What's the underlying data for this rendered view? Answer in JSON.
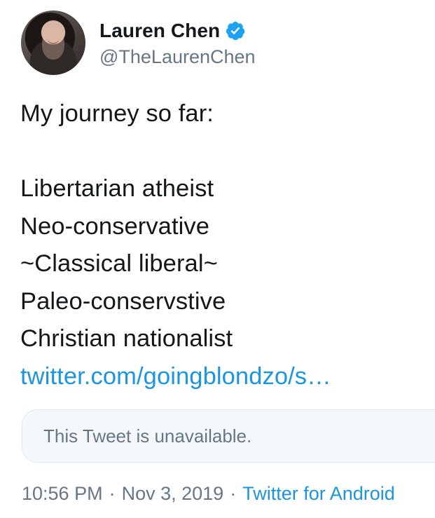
{
  "user": {
    "display_name": "Lauren Chen",
    "handle": "@TheLaurenChen",
    "avatar_icon": "profile-photo",
    "verified_icon": "verified-badge-icon"
  },
  "tweet": {
    "lines": [
      "My journey so far:",
      "",
      "Libertarian atheist",
      "Neo-conservative",
      "~Classical liberal~",
      "Paleo-conservstive",
      "Christian nationalist"
    ],
    "link_text": "twitter.com/goingblondzo/s…"
  },
  "quoted_tweet": {
    "text": "This Tweet is unavailable."
  },
  "meta": {
    "time": "10:56 PM",
    "separator": "·",
    "date": "Nov 3, 2019",
    "source": "Twitter for Android"
  },
  "colors": {
    "text": "#14171a",
    "secondary_text": "#657786",
    "link": "#1b95e0",
    "verified": "#1da1f2",
    "quote_background": "#f5f8fa",
    "quote_border": "#e1e8ed"
  }
}
